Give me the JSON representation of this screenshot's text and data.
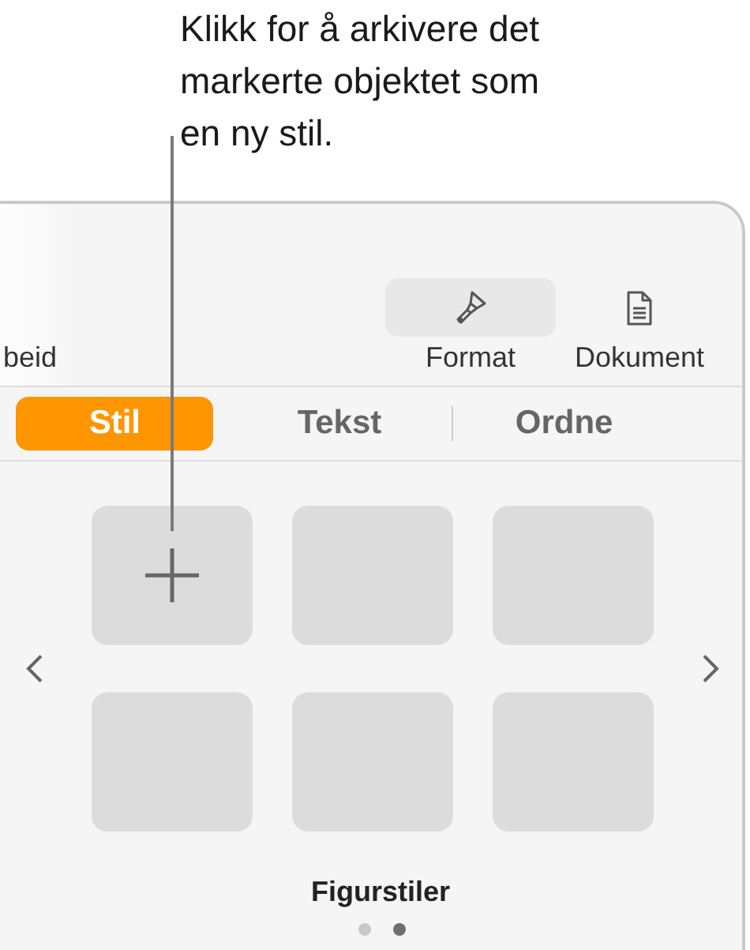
{
  "callout": {
    "text": "Klikk for å arkivere det\nmarkerte objektet som\nen ny stil."
  },
  "toolbar": {
    "cut_label": "beid",
    "items": [
      {
        "kind": "format",
        "label": "Format",
        "selected": true
      },
      {
        "kind": "document",
        "label": "Dokument",
        "selected": false
      }
    ]
  },
  "tabs": [
    {
      "label": "Stil",
      "selected": true
    },
    {
      "label": "Tekst",
      "selected": false
    },
    {
      "label": "Ordne",
      "selected": false
    }
  ],
  "styles": {
    "tiles": [
      {
        "kind": "add"
      },
      {
        "kind": "style"
      },
      {
        "kind": "style"
      },
      {
        "kind": "style"
      },
      {
        "kind": "style"
      },
      {
        "kind": "style"
      }
    ],
    "title": "Figurstiler",
    "pages": [
      {
        "selected": false
      },
      {
        "selected": true
      }
    ]
  }
}
